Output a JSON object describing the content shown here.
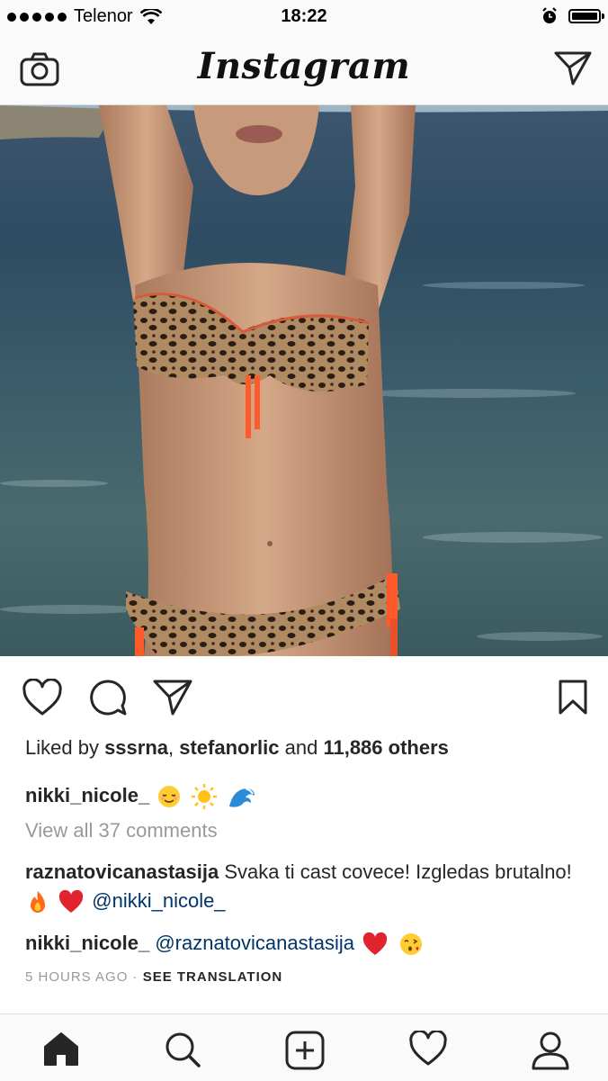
{
  "status_bar": {
    "carrier": "Telenor",
    "time": "18:22"
  },
  "header": {
    "logo": "Instagram"
  },
  "post": {
    "liked_by_prefix": "Liked by ",
    "liked_user_1": "sssrna",
    "separator": ", ",
    "liked_user_2": "stefanorlic",
    "and_text": " and ",
    "others_count": "11,886 others",
    "caption_user": "nikki_nicole_",
    "view_all_comments": "View all 37 comments",
    "comments": [
      {
        "user": "raznatovicanastasija",
        "text": " Svaka ti cast covece! Izgledas brutalno!",
        "mention": "@nikki_nicole_"
      },
      {
        "user": "nikki_nicole_",
        "mention": "@raznatovicanastasija"
      }
    ],
    "time_ago": "5 HOURS AGO",
    "meta_sep": " · ",
    "see_translation": "SEE TRANSLATION"
  },
  "icons": {
    "camera": "camera-icon",
    "direct": "paper-plane-icon",
    "like": "heart-icon",
    "comment": "comment-icon",
    "share": "paper-plane-icon",
    "save": "bookmark-icon",
    "home": "home-icon",
    "search": "search-icon",
    "add": "plus-square-icon",
    "activity": "heart-icon",
    "profile": "person-icon"
  },
  "colors": {
    "text": "#262626",
    "muted": "#999999",
    "mention": "#003569",
    "emoji_heart": "#e0242f"
  }
}
